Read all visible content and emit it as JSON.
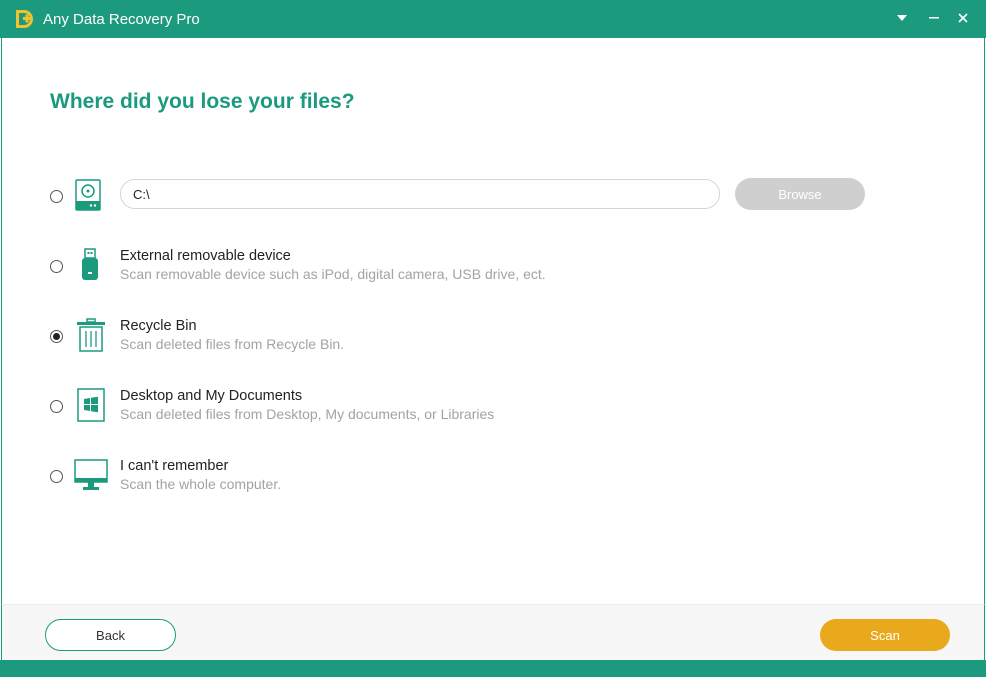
{
  "app": {
    "title": "Any Data Recovery Pro",
    "accent_color": "#1b9a7e",
    "logo_icon": "app-logo-icon"
  },
  "window_controls": {
    "menu_icon": "dropdown-triangle-icon",
    "minimize_icon": "minimize-icon",
    "close_icon": "close-icon"
  },
  "main": {
    "heading": "Where did you lose your files?",
    "path_option": {
      "icon": "hard-drive-icon",
      "path_value": "C:\\",
      "browse_label": "Browse",
      "selected": false
    },
    "options": [
      {
        "title": "External removable device",
        "description": "Scan removable device such as iPod, digital camera, USB drive, ect.",
        "icon": "usb-drive-icon",
        "selected": false
      },
      {
        "title": "Recycle Bin",
        "description": "Scan deleted files from Recycle Bin.",
        "icon": "recycle-bin-icon",
        "selected": true
      },
      {
        "title": "Desktop and My Documents",
        "description": "Scan deleted files from Desktop, My documents, or Libraries",
        "icon": "desktop-windows-icon",
        "selected": false
      },
      {
        "title": "I can't remember",
        "description": "Scan the whole computer.",
        "icon": "monitor-icon",
        "selected": false
      }
    ]
  },
  "footer": {
    "back_label": "Back",
    "scan_label": "Scan",
    "scan_color": "#e9a91c"
  }
}
